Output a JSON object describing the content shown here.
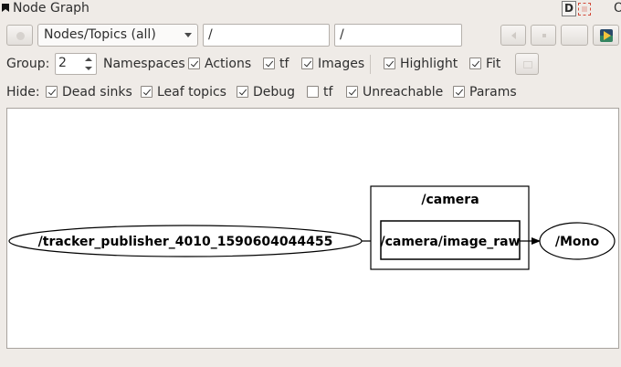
{
  "window": {
    "title": "Node Graph",
    "dock_label": "D",
    "close_label": "O"
  },
  "toolbar": {
    "mode_select_value": "Nodes/Topics (all)",
    "namespace_filter_value": "/",
    "topic_filter_value": "/"
  },
  "options": {
    "group_label": "Group:",
    "group_value": "2",
    "namespaces_label": "Namespaces",
    "actions_label": "Actions",
    "actions_checked": true,
    "tf_label": "tf",
    "tf_checked": true,
    "images_label": "Images",
    "images_checked": true,
    "highlight_label": "Highlight",
    "highlight_checked": true,
    "fit_label": "Fit",
    "fit_checked": true
  },
  "hide": {
    "hide_label": "Hide:",
    "dead_sinks_label": "Dead sinks",
    "dead_sinks_checked": true,
    "leaf_topics_label": "Leaf topics",
    "leaf_topics_checked": true,
    "debug_label": "Debug",
    "debug_checked": true,
    "tf_label": "tf",
    "tf_checked": false,
    "unreachable_label": "Unreachable",
    "unreachable_checked": true,
    "params_label": "Params",
    "params_checked": true
  },
  "graph": {
    "publisher_node": "/tracker_publisher_4010_1590604044455",
    "namespace_cluster": "/camera",
    "topic": "/camera/image_raw",
    "subscriber_node": "/Mono"
  }
}
